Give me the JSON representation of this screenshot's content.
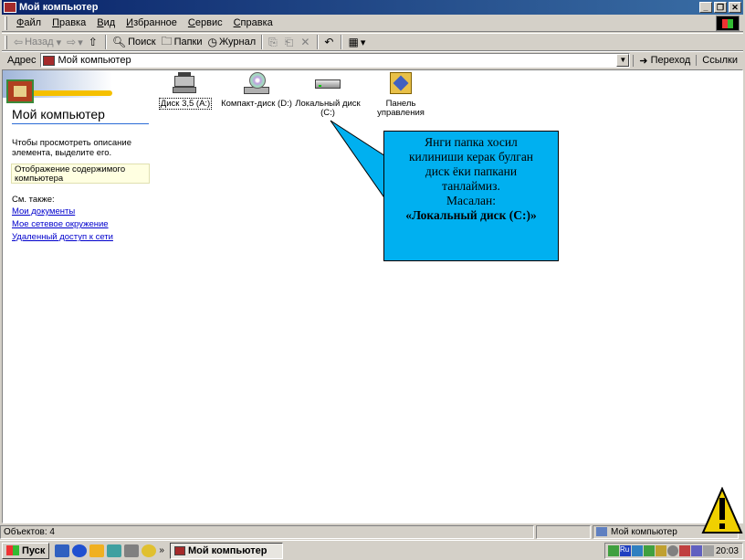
{
  "window": {
    "title": "Мой компьютер"
  },
  "menu": [
    {
      "u": "Ф",
      "rest": "айл"
    },
    {
      "u": "П",
      "rest": "равка"
    },
    {
      "u": "В",
      "rest": "ид"
    },
    {
      "u": "И",
      "rest": "збранное"
    },
    {
      "u": "С",
      "rest": "ервис"
    },
    {
      "u": "С",
      "rest": "правка"
    }
  ],
  "toolbar": {
    "back": "Назад",
    "search": "Поиск",
    "folders": "Папки",
    "history": "Журнал"
  },
  "address": {
    "label": "Адрес",
    "value": "Мой компьютер",
    "go": "Переход",
    "links": "Ссылки"
  },
  "left_panel": {
    "title": "Мой компьютер",
    "desc": "Чтобы просмотреть описание элемента, выделите его.",
    "hint": "Отображение содержимого компьютера",
    "see_also": "См. также:",
    "links": [
      "Мои документы",
      "Мое сетевое окружение",
      "Удаленный доступ к сети"
    ]
  },
  "drives": [
    {
      "label": "Диск 3,5 (A:)",
      "icon": "floppy-drive-icon"
    },
    {
      "label": "Компакт-диск (D:)",
      "icon": "cd-drive-icon"
    },
    {
      "label": "Локальный диск (C:)",
      "icon": "hard-drive-icon"
    },
    {
      "label": "Панель управления",
      "icon": "control-panel-icon"
    }
  ],
  "callout": {
    "line1": "Янги папка хосил",
    "line2": "килиниши керак булган",
    "line3": "диск ёки папкани",
    "line4": "танлаймиз.",
    "line5": "Масалан:",
    "line6": "«Локальный диск (С:)»",
    "color": "#00b0f0"
  },
  "status": {
    "objects": "Объектов: 4",
    "location": "Мой компьютер"
  },
  "taskbar": {
    "start": "Пуск",
    "task": "Мой компьютер",
    "clock": "20:03"
  }
}
